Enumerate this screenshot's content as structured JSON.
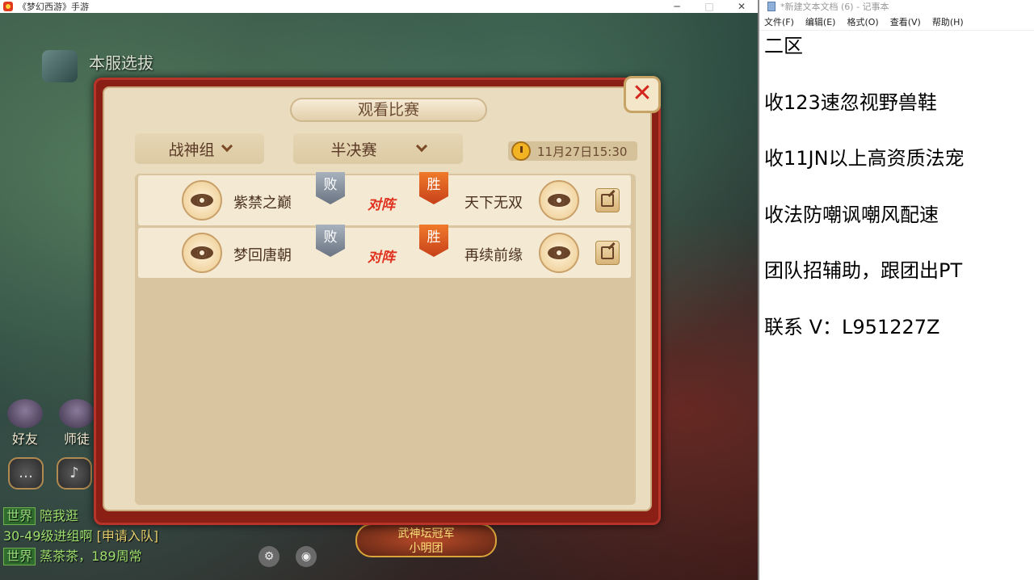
{
  "game": {
    "window_title": "《梦幻西游》手游",
    "controls": {
      "minimize": "─",
      "maximize": "□",
      "close": "✕"
    },
    "server_label": "本服选拔",
    "side_buttons": {
      "friends": "好友",
      "mentor": "师徒"
    },
    "chat": [
      {
        "channel": "世界",
        "text": "陪我逛"
      },
      {
        "channel": "",
        "text": "30-49级进组啊",
        "link": "[申请入队]"
      },
      {
        "channel": "世界",
        "text": "蒸茶茶，189周常"
      }
    ],
    "event_banner": {
      "line1": "武神坛冠军",
      "line2": "小明团"
    }
  },
  "dialog": {
    "title": "观看比赛",
    "close_label": "✕",
    "group_filter": "战神组",
    "round_filter": "半决赛",
    "datetime": "11月27日15:30",
    "vs_label": "对阵",
    "matches": [
      {
        "left_team": "紫禁之巅",
        "left_result": "败",
        "right_team": "天下无双",
        "right_result": "胜"
      },
      {
        "left_team": "梦回唐朝",
        "left_result": "败",
        "right_team": "再续前缘",
        "right_result": "胜"
      }
    ]
  },
  "notepad": {
    "window_title": "*新建文本文档 (6) - 记事本",
    "menu": [
      "文件(F)",
      "编辑(E)",
      "格式(O)",
      "查看(V)",
      "帮助(H)"
    ],
    "lines": [
      "二区",
      "收123速忽视野兽鞋",
      "收11JN以上高资质法宠",
      "收法防嘲讽嘲风配速",
      "团队招辅助，跟团出PT",
      "联系 V：L951227Z"
    ]
  }
}
